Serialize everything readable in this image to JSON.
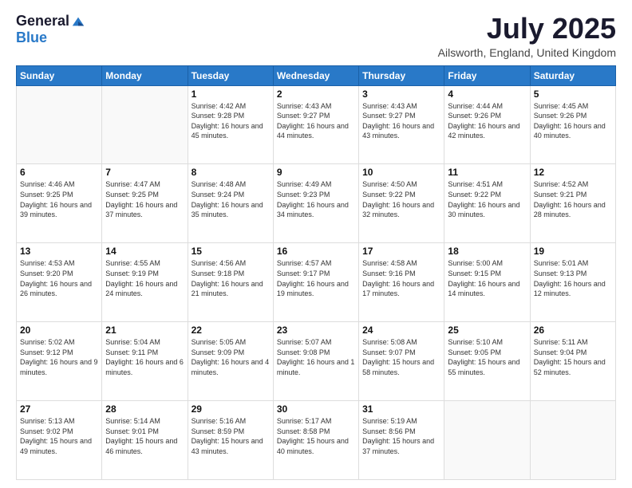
{
  "header": {
    "logo_general": "General",
    "logo_blue": "Blue",
    "month_title": "July 2025",
    "location": "Ailsworth, England, United Kingdom"
  },
  "days_of_week": [
    "Sunday",
    "Monday",
    "Tuesday",
    "Wednesday",
    "Thursday",
    "Friday",
    "Saturday"
  ],
  "weeks": [
    [
      {
        "day": "",
        "info": ""
      },
      {
        "day": "",
        "info": ""
      },
      {
        "day": "1",
        "info": "Sunrise: 4:42 AM\nSunset: 9:28 PM\nDaylight: 16 hours and 45 minutes."
      },
      {
        "day": "2",
        "info": "Sunrise: 4:43 AM\nSunset: 9:27 PM\nDaylight: 16 hours and 44 minutes."
      },
      {
        "day": "3",
        "info": "Sunrise: 4:43 AM\nSunset: 9:27 PM\nDaylight: 16 hours and 43 minutes."
      },
      {
        "day": "4",
        "info": "Sunrise: 4:44 AM\nSunset: 9:26 PM\nDaylight: 16 hours and 42 minutes."
      },
      {
        "day": "5",
        "info": "Sunrise: 4:45 AM\nSunset: 9:26 PM\nDaylight: 16 hours and 40 minutes."
      }
    ],
    [
      {
        "day": "6",
        "info": "Sunrise: 4:46 AM\nSunset: 9:25 PM\nDaylight: 16 hours and 39 minutes."
      },
      {
        "day": "7",
        "info": "Sunrise: 4:47 AM\nSunset: 9:25 PM\nDaylight: 16 hours and 37 minutes."
      },
      {
        "day": "8",
        "info": "Sunrise: 4:48 AM\nSunset: 9:24 PM\nDaylight: 16 hours and 35 minutes."
      },
      {
        "day": "9",
        "info": "Sunrise: 4:49 AM\nSunset: 9:23 PM\nDaylight: 16 hours and 34 minutes."
      },
      {
        "day": "10",
        "info": "Sunrise: 4:50 AM\nSunset: 9:22 PM\nDaylight: 16 hours and 32 minutes."
      },
      {
        "day": "11",
        "info": "Sunrise: 4:51 AM\nSunset: 9:22 PM\nDaylight: 16 hours and 30 minutes."
      },
      {
        "day": "12",
        "info": "Sunrise: 4:52 AM\nSunset: 9:21 PM\nDaylight: 16 hours and 28 minutes."
      }
    ],
    [
      {
        "day": "13",
        "info": "Sunrise: 4:53 AM\nSunset: 9:20 PM\nDaylight: 16 hours and 26 minutes."
      },
      {
        "day": "14",
        "info": "Sunrise: 4:55 AM\nSunset: 9:19 PM\nDaylight: 16 hours and 24 minutes."
      },
      {
        "day": "15",
        "info": "Sunrise: 4:56 AM\nSunset: 9:18 PM\nDaylight: 16 hours and 21 minutes."
      },
      {
        "day": "16",
        "info": "Sunrise: 4:57 AM\nSunset: 9:17 PM\nDaylight: 16 hours and 19 minutes."
      },
      {
        "day": "17",
        "info": "Sunrise: 4:58 AM\nSunset: 9:16 PM\nDaylight: 16 hours and 17 minutes."
      },
      {
        "day": "18",
        "info": "Sunrise: 5:00 AM\nSunset: 9:15 PM\nDaylight: 16 hours and 14 minutes."
      },
      {
        "day": "19",
        "info": "Sunrise: 5:01 AM\nSunset: 9:13 PM\nDaylight: 16 hours and 12 minutes."
      }
    ],
    [
      {
        "day": "20",
        "info": "Sunrise: 5:02 AM\nSunset: 9:12 PM\nDaylight: 16 hours and 9 minutes."
      },
      {
        "day": "21",
        "info": "Sunrise: 5:04 AM\nSunset: 9:11 PM\nDaylight: 16 hours and 6 minutes."
      },
      {
        "day": "22",
        "info": "Sunrise: 5:05 AM\nSunset: 9:09 PM\nDaylight: 16 hours and 4 minutes."
      },
      {
        "day": "23",
        "info": "Sunrise: 5:07 AM\nSunset: 9:08 PM\nDaylight: 16 hours and 1 minute."
      },
      {
        "day": "24",
        "info": "Sunrise: 5:08 AM\nSunset: 9:07 PM\nDaylight: 15 hours and 58 minutes."
      },
      {
        "day": "25",
        "info": "Sunrise: 5:10 AM\nSunset: 9:05 PM\nDaylight: 15 hours and 55 minutes."
      },
      {
        "day": "26",
        "info": "Sunrise: 5:11 AM\nSunset: 9:04 PM\nDaylight: 15 hours and 52 minutes."
      }
    ],
    [
      {
        "day": "27",
        "info": "Sunrise: 5:13 AM\nSunset: 9:02 PM\nDaylight: 15 hours and 49 minutes."
      },
      {
        "day": "28",
        "info": "Sunrise: 5:14 AM\nSunset: 9:01 PM\nDaylight: 15 hours and 46 minutes."
      },
      {
        "day": "29",
        "info": "Sunrise: 5:16 AM\nSunset: 8:59 PM\nDaylight: 15 hours and 43 minutes."
      },
      {
        "day": "30",
        "info": "Sunrise: 5:17 AM\nSunset: 8:58 PM\nDaylight: 15 hours and 40 minutes."
      },
      {
        "day": "31",
        "info": "Sunrise: 5:19 AM\nSunset: 8:56 PM\nDaylight: 15 hours and 37 minutes."
      },
      {
        "day": "",
        "info": ""
      },
      {
        "day": "",
        "info": ""
      }
    ]
  ]
}
